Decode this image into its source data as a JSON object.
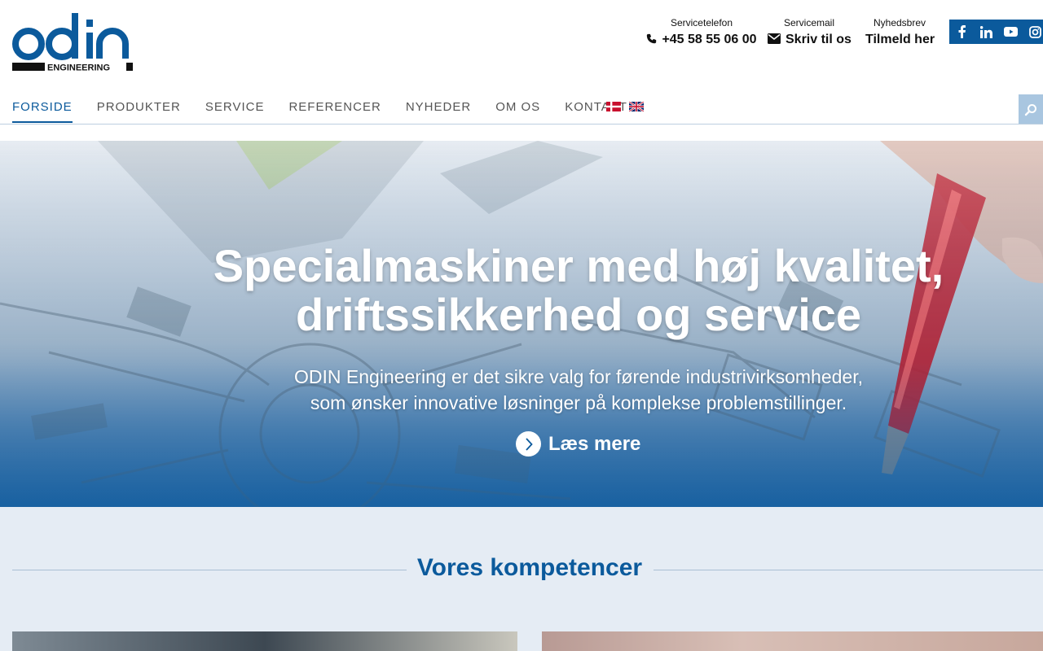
{
  "brand": {
    "logo_text": "odin",
    "logo_sub": "ENGINEERING",
    "primary_color": "#0b5a9c"
  },
  "contact": {
    "phone_label": "Servicetelefon",
    "phone_value": "+45 58 55 06 00",
    "mail_label": "Servicemail",
    "mail_value": "Skriv til os",
    "news_label": "Nyhedsbrev",
    "news_value": "Tilmeld her"
  },
  "social": [
    "facebook-icon",
    "linkedin-icon",
    "youtube-icon",
    "instagram-icon"
  ],
  "nav": {
    "items": [
      {
        "label": "FORSIDE",
        "active": true
      },
      {
        "label": "PRODUKTER",
        "active": false
      },
      {
        "label": "SERVICE",
        "active": false
      },
      {
        "label": "REFERENCER",
        "active": false
      },
      {
        "label": "NYHEDER",
        "active": false
      },
      {
        "label": "OM OS",
        "active": false
      },
      {
        "label": "KONTAKT",
        "active": false
      }
    ],
    "languages": [
      "danish-flag",
      "english-flag"
    ]
  },
  "hero": {
    "title_line1": "Specialmaskiner med høj kvalitet,",
    "title_line2": "driftssikkerhed og service",
    "sub_line1": "ODIN Engineering er det sikre valg for førende industrivirksomheder,",
    "sub_line2": "som ønsker innovative løsninger på komplekse problemstillinger.",
    "cta": "Læs mere"
  },
  "section": {
    "title": "Vores kompetencer"
  }
}
